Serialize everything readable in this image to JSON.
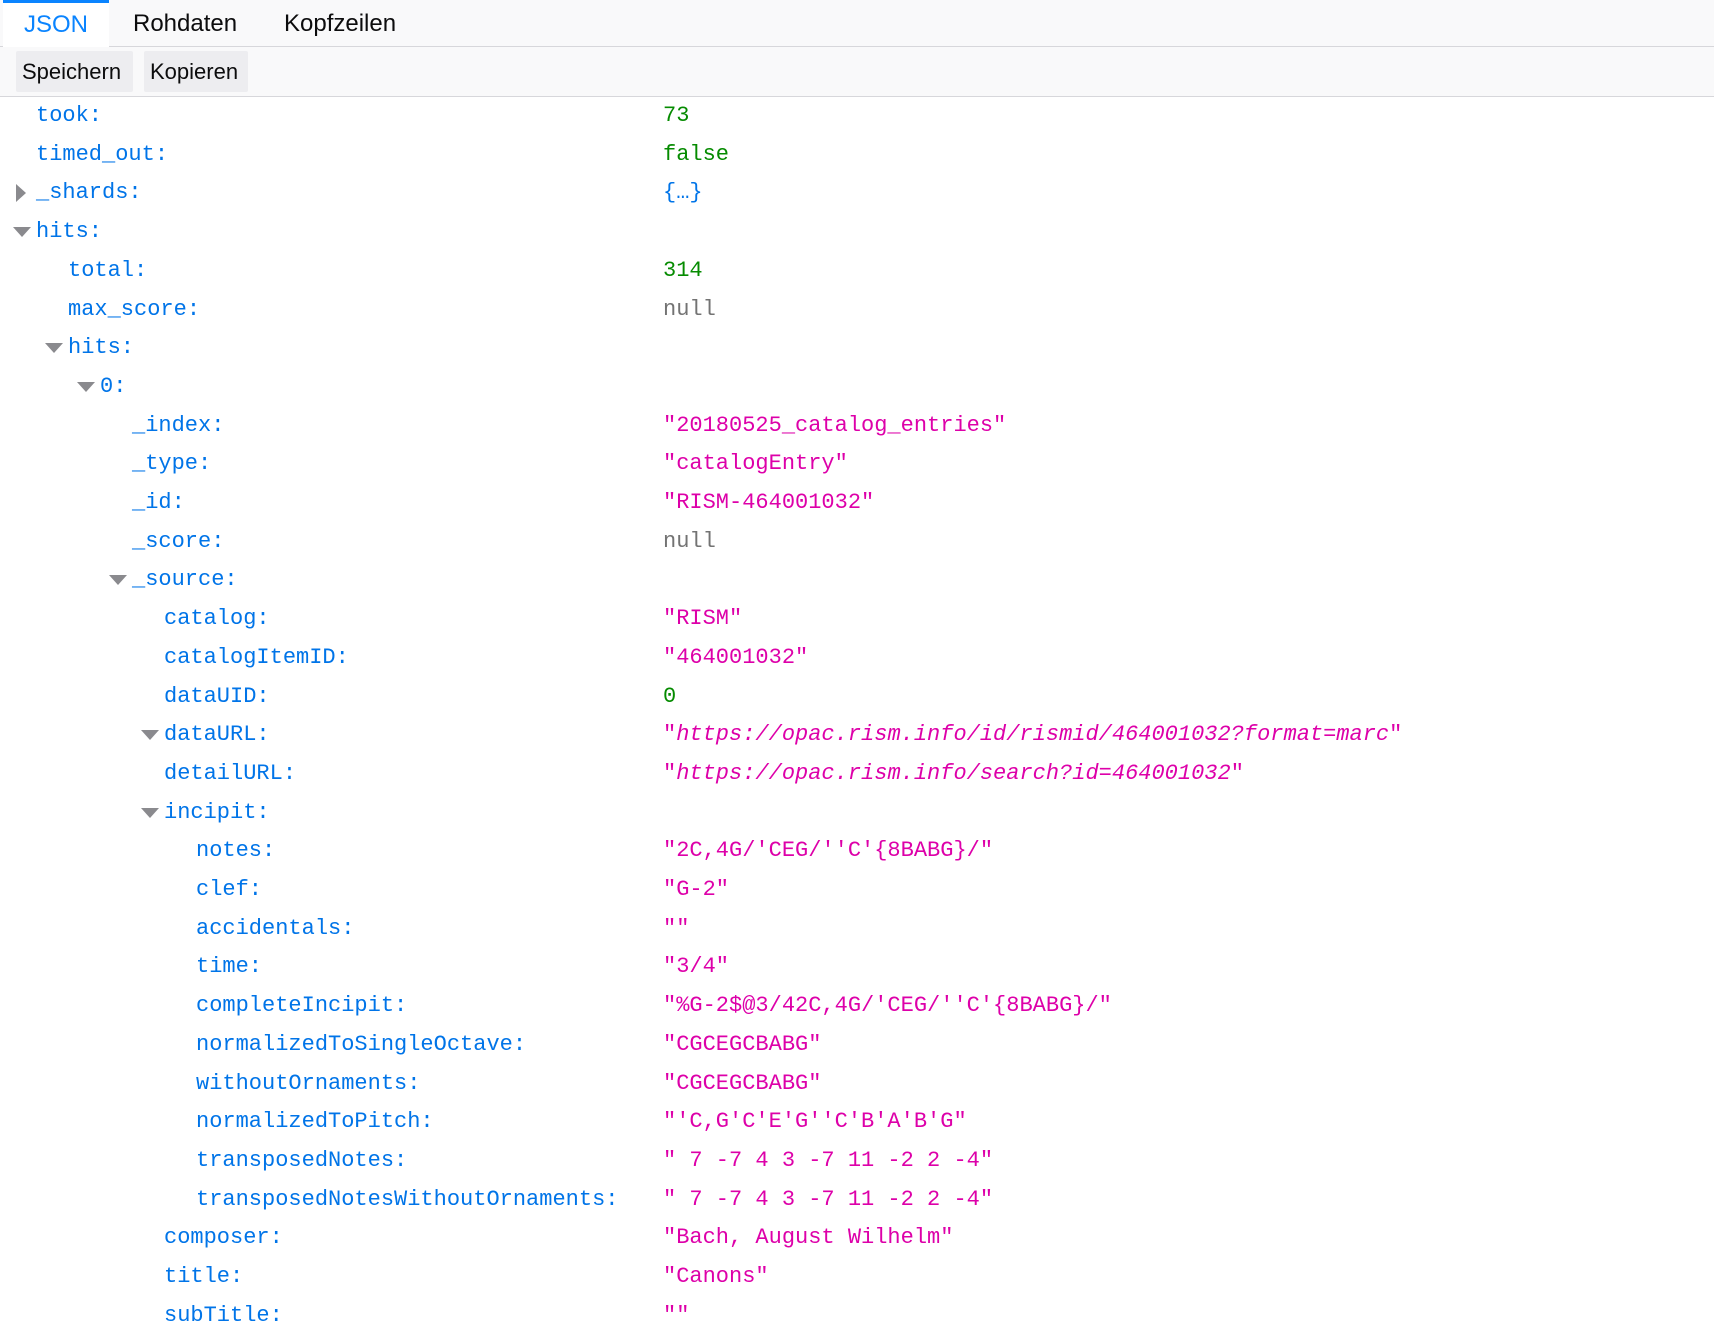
{
  "tabs": {
    "json": "JSON",
    "raw": "Rohdaten",
    "headers": "Kopfzeilen"
  },
  "toolbar": {
    "save": "Speichern",
    "copy": "Kopieren"
  },
  "rows": [
    {
      "key": "took:",
      "value": "73",
      "kind": "num",
      "depth": 0,
      "twisty": "none"
    },
    {
      "key": "timed_out:",
      "value": "false",
      "kind": "bool",
      "depth": 0,
      "twisty": "none"
    },
    {
      "key": "_shards:",
      "value": "{…}",
      "kind": "obj",
      "depth": 0,
      "twisty": "closed"
    },
    {
      "key": "hits:",
      "value": "",
      "kind": "none",
      "depth": 0,
      "twisty": "open"
    },
    {
      "key": "total:",
      "value": "314",
      "kind": "num",
      "depth": 1,
      "twisty": "none"
    },
    {
      "key": "max_score:",
      "value": "null",
      "kind": "null",
      "depth": 1,
      "twisty": "none"
    },
    {
      "key": "hits:",
      "value": "",
      "kind": "none",
      "depth": 1,
      "twisty": "open"
    },
    {
      "key": "0:",
      "value": "",
      "kind": "none",
      "depth": 2,
      "twisty": "open"
    },
    {
      "key": "_index:",
      "value": "\"20180525_catalog_entries\"",
      "kind": "str",
      "depth": 3,
      "twisty": "none"
    },
    {
      "key": "_type:",
      "value": "\"catalogEntry\"",
      "kind": "str",
      "depth": 3,
      "twisty": "none"
    },
    {
      "key": "_id:",
      "value": "\"RISM-464001032\"",
      "kind": "str",
      "depth": 3,
      "twisty": "none"
    },
    {
      "key": "_score:",
      "value": "null",
      "kind": "null",
      "depth": 3,
      "twisty": "none"
    },
    {
      "key": "_source:",
      "value": "",
      "kind": "none",
      "depth": 3,
      "twisty": "open"
    },
    {
      "key": "catalog:",
      "value": "\"RISM\"",
      "kind": "str",
      "depth": 4,
      "twisty": "none"
    },
    {
      "key": "catalogItemID:",
      "value": "\"464001032\"",
      "kind": "str",
      "depth": 4,
      "twisty": "none"
    },
    {
      "key": "dataUID:",
      "value": "0",
      "kind": "num",
      "depth": 4,
      "twisty": "none"
    },
    {
      "key": "dataURL:",
      "value": "https://opac.rism.info/id/rismid/464001032?format=marc",
      "kind": "url",
      "depth": 4,
      "twisty": "open"
    },
    {
      "key": "detailURL:",
      "value": "https://opac.rism.info/search?id=464001032",
      "kind": "url",
      "depth": 4,
      "twisty": "none"
    },
    {
      "key": "incipit:",
      "value": "",
      "kind": "none",
      "depth": 4,
      "twisty": "open"
    },
    {
      "key": "notes:",
      "value": "\"2C,4G/'CEG/''C'{8BABG}/\"",
      "kind": "str",
      "depth": 5,
      "twisty": "none"
    },
    {
      "key": "clef:",
      "value": "\"G-2\"",
      "kind": "str",
      "depth": 5,
      "twisty": "none"
    },
    {
      "key": "accidentals:",
      "value": "\"\"",
      "kind": "str",
      "depth": 5,
      "twisty": "none"
    },
    {
      "key": "time:",
      "value": "\"3/4\"",
      "kind": "str",
      "depth": 5,
      "twisty": "none"
    },
    {
      "key": "completeIncipit:",
      "value": "\"%G-2$@3/42C,4G/'CEG/''C'{8BABG}/\"",
      "kind": "str",
      "depth": 5,
      "twisty": "none"
    },
    {
      "key": "normalizedToSingleOctave:",
      "value": "\"CGCEGCBABG\"",
      "kind": "str",
      "depth": 5,
      "twisty": "none"
    },
    {
      "key": "withoutOrnaments:",
      "value": "\"CGCEGCBABG\"",
      "kind": "str",
      "depth": 5,
      "twisty": "none"
    },
    {
      "key": "normalizedToPitch:",
      "value": "\"'C,G'C'E'G''C'B'A'B'G\"",
      "kind": "str",
      "depth": 5,
      "twisty": "none"
    },
    {
      "key": "transposedNotes:",
      "value": "\" 7 -7 4 3 -7 11 -2 2 -4\"",
      "kind": "str",
      "depth": 5,
      "twisty": "none"
    },
    {
      "key": "transposedNotesWithoutOrnaments:",
      "value": "\" 7 -7 4 3 -7 11 -2 2 -4\"",
      "kind": "str",
      "depth": 5,
      "twisty": "none"
    },
    {
      "key": "composer:",
      "value": "\"Bach, August Wilhelm\"",
      "kind": "str",
      "depth": 4,
      "twisty": "none"
    },
    {
      "key": "title:",
      "value": "\"Canons\"",
      "kind": "str",
      "depth": 4,
      "twisty": "none"
    },
    {
      "key": "subTitle:",
      "value": "\"\"",
      "kind": "str",
      "depth": 4,
      "twisty": "none"
    }
  ]
}
